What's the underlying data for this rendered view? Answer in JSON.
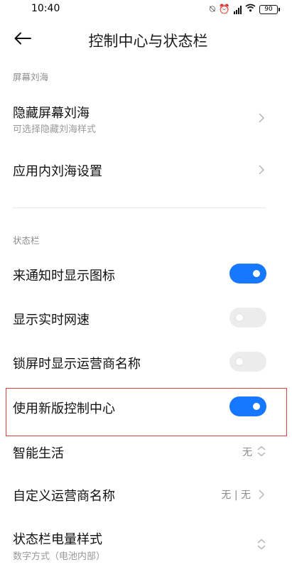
{
  "status_bar": {
    "time": "10:40",
    "battery": "90"
  },
  "header": {
    "title": "控制中心与状态栏"
  },
  "sections": {
    "notch": {
      "label": "屏幕刘海"
    },
    "statusbar": {
      "label": "状态栏"
    }
  },
  "rows": {
    "hide_notch": {
      "label": "隐藏屏幕刘海",
      "subtitle": "可选择隐藏刘海样式"
    },
    "app_notch": {
      "label": "应用内刘海设置"
    },
    "notify_icon": {
      "label": "来通知时显示图标",
      "on": true
    },
    "net_speed": {
      "label": "显示实时网速",
      "on": false
    },
    "carrier_lock": {
      "label": "锁屏时显示运营商名称",
      "on": false
    },
    "new_control": {
      "label": "使用新版控制中心",
      "on": true
    },
    "smart_life": {
      "label": "智能生活",
      "value": "无"
    },
    "custom_carrier": {
      "label": "自定义运营商名称",
      "value": "无 | 无"
    },
    "battery_style": {
      "label": "状态栏电量样式",
      "subtitle": "数字方式（电池内部）"
    }
  },
  "colors": {
    "accent": "#1677ff",
    "highlight": "#e0403a"
  }
}
